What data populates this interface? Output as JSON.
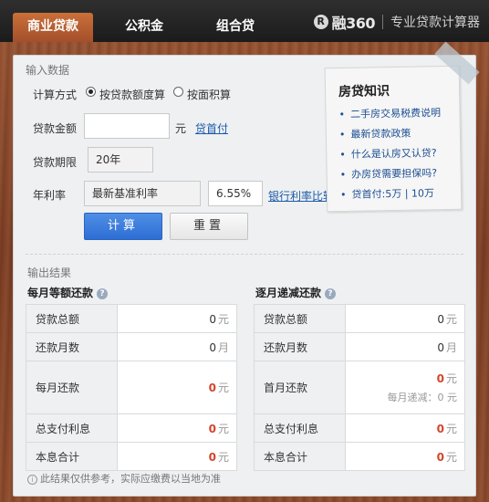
{
  "tabs": [
    {
      "label": "商业贷款"
    },
    {
      "label": "公积金"
    },
    {
      "label": "组合贷"
    }
  ],
  "brand": {
    "logo_glyph": "R",
    "name": "融360",
    "slogan": "专业贷款计算器"
  },
  "input_section": {
    "title": "输入数据",
    "calc_method": {
      "label": "计算方式",
      "options": [
        {
          "label": "按贷款额度算",
          "checked": true
        },
        {
          "label": "按面积算",
          "checked": false
        }
      ]
    },
    "amount": {
      "label": "贷款金额",
      "value": "",
      "unit": "元",
      "link": "贷首付"
    },
    "term": {
      "label": "贷款期限",
      "value": "20年"
    },
    "rate": {
      "label": "年利率",
      "type_value": "最新基准利率",
      "rate_value": "6.55%",
      "link": "银行利率比较"
    },
    "buttons": {
      "calc": "计算",
      "reset": "重置"
    }
  },
  "knowledge": {
    "title": "房贷知识",
    "items": [
      "二手房交易税费说明",
      "最新贷款政策",
      "什么是认房又认贷?",
      "办房贷需要担保吗?",
      "贷首付:5万 | 10万"
    ]
  },
  "output_section": {
    "title": "输出结果",
    "equal_installment": {
      "title": "每月等额还款",
      "rows": [
        {
          "label": "贷款总额",
          "value": "0",
          "unit": "元",
          "highlight": false
        },
        {
          "label": "还款月数",
          "value": "0",
          "unit": "月",
          "highlight": false
        },
        {
          "label": "每月还款",
          "value": "0",
          "unit": "元",
          "highlight": true
        },
        {
          "label": "总支付利息",
          "value": "0",
          "unit": "元",
          "highlight": true
        },
        {
          "label": "本息合计",
          "value": "0",
          "unit": "元",
          "highlight": true
        }
      ]
    },
    "decreasing": {
      "title": "逐月递减还款",
      "rows": [
        {
          "label": "贷款总额",
          "value": "0",
          "unit": "元",
          "highlight": false
        },
        {
          "label": "还款月数",
          "value": "0",
          "unit": "月",
          "highlight": false
        },
        {
          "label": "首月还款",
          "value": "0",
          "unit": "元",
          "highlight": true,
          "sub": "每月递减：0 元"
        },
        {
          "label": "总支付利息",
          "value": "0",
          "unit": "元",
          "highlight": true
        },
        {
          "label": "本息合计",
          "value": "0",
          "unit": "元",
          "highlight": true
        }
      ]
    },
    "footnote": "此结果仅供参考，实际应缴费以当地为准"
  },
  "colors": {
    "accent_tab": "#b85a2f",
    "primary_button": "#3a78d8",
    "result_red": "#d2452b",
    "link": "#1d5ba8"
  }
}
